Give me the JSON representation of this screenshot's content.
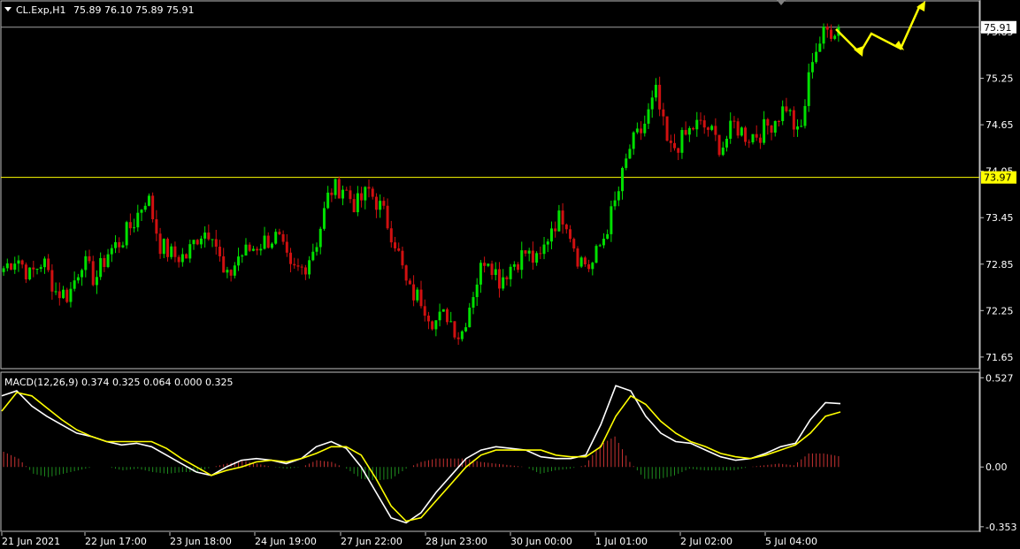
{
  "header": {
    "symbol_label": "CL.Exp,H1",
    "ohlc_label": "75.89 76.10 75.89 75.91"
  },
  "macd_panel": {
    "label": "MACD(12,26,9) 0.374 0.325 0.064 0.000 0.325"
  },
  "colors": {
    "background": "#000000",
    "bull_candle": "#00e000",
    "bear_candle": "#d01010",
    "macd_line": "#ffffff",
    "signal_line": "#ffff00",
    "hist_up": "#c83232",
    "hist_down": "#1e8c1e",
    "hline": "#ffff00",
    "bid_line": "#a0a0a0",
    "frame": "#c0c0c0",
    "arrow": "#ffff00"
  },
  "chart_data": [
    {
      "type": "candlestick",
      "title": "",
      "yticks": [
        "75.85",
        "75.25",
        "74.65",
        "74.05",
        "73.45",
        "72.85",
        "72.25",
        "71.65"
      ],
      "ylim": [
        71.5,
        76.25
      ],
      "current_price_label": "75.91",
      "hline_price_label": "73.97",
      "current_price": 75.91,
      "hline_price": 73.97,
      "xtick_labels": [
        "21 Jun 2021",
        "22 Jun 17:00",
        "23 Jun 18:00",
        "24 Jun 19:00",
        "27 Jun 22:00",
        "28 Jun 23:00",
        "30 Jun 00:00",
        "1 Jul 01:00",
        "2 Jul 02:00",
        "5 Jul 04:00"
      ],
      "close_path": [
        72.8,
        72.95,
        72.7,
        72.9,
        72.5,
        72.45,
        72.9,
        72.65,
        73.0,
        73.15,
        73.4,
        73.75,
        73.1,
        72.95,
        72.95,
        73.25,
        73.3,
        72.6,
        72.95,
        73.05,
        73.15,
        73.2,
        72.75,
        72.8,
        73.15,
        73.8,
        73.85,
        73.6,
        73.8,
        73.55,
        73.15,
        72.5,
        72.4,
        72.1,
        72.2,
        71.9,
        72.5,
        73.0,
        72.65,
        72.85,
        73.0,
        72.85,
        73.35,
        73.5,
        72.95,
        72.8,
        73.2,
        73.7,
        74.35,
        74.6,
        75.05,
        74.3,
        74.45,
        74.65,
        74.6,
        74.35,
        74.65,
        74.5,
        74.55,
        74.7,
        74.9,
        74.45,
        75.55,
        75.85,
        75.91
      ],
      "macd_ticks": [
        "0.527",
        "0.00",
        "-0.353"
      ],
      "macd_ylim": [
        -0.38,
        0.56
      ],
      "macd_line": [
        0.42,
        0.45,
        0.36,
        0.3,
        0.25,
        0.2,
        0.18,
        0.15,
        0.13,
        0.14,
        0.12,
        0.07,
        0.02,
        -0.03,
        -0.05,
        0.0,
        0.04,
        0.05,
        0.04,
        0.02,
        0.05,
        0.12,
        0.15,
        0.11,
        0.0,
        -0.15,
        -0.3,
        -0.33,
        -0.27,
        -0.15,
        -0.05,
        0.05,
        0.1,
        0.12,
        0.11,
        0.1,
        0.06,
        0.05,
        0.05,
        0.07,
        0.25,
        0.48,
        0.45,
        0.3,
        0.2,
        0.15,
        0.14,
        0.1,
        0.06,
        0.04,
        0.05,
        0.08,
        0.12,
        0.14,
        0.28,
        0.38,
        0.374
      ],
      "signal_line": [
        0.33,
        0.44,
        0.42,
        0.35,
        0.28,
        0.22,
        0.18,
        0.15,
        0.15,
        0.15,
        0.15,
        0.11,
        0.05,
        0.0,
        -0.05,
        -0.02,
        0.0,
        0.03,
        0.04,
        0.03,
        0.05,
        0.08,
        0.12,
        0.12,
        0.07,
        -0.07,
        -0.23,
        -0.32,
        -0.3,
        -0.2,
        -0.1,
        -0.0,
        0.07,
        0.1,
        0.1,
        0.1,
        0.1,
        0.07,
        0.06,
        0.06,
        0.12,
        0.3,
        0.42,
        0.37,
        0.27,
        0.2,
        0.15,
        0.12,
        0.08,
        0.06,
        0.05,
        0.07,
        0.1,
        0.13,
        0.2,
        0.3,
        0.325
      ],
      "histogram": [
        0.09,
        0.05,
        -0.04,
        -0.06,
        -0.04,
        -0.02,
        0.0,
        0.0,
        -0.02,
        -0.01,
        -0.03,
        -0.04,
        -0.03,
        -0.03,
        0.0,
        0.02,
        0.04,
        0.02,
        0.0,
        -0.01,
        0.0,
        0.04,
        0.03,
        -0.01,
        -0.07,
        -0.08,
        -0.07,
        -0.01,
        0.03,
        0.05,
        0.05,
        0.05,
        0.03,
        0.02,
        0.01,
        0.0,
        -0.04,
        -0.02,
        -0.01,
        0.01,
        0.13,
        0.18,
        0.03,
        -0.07,
        -0.07,
        -0.05,
        -0.01,
        -0.02,
        -0.02,
        -0.02,
        0.0,
        0.01,
        0.02,
        0.01,
        0.08,
        0.08,
        0.064
      ]
    }
  ]
}
